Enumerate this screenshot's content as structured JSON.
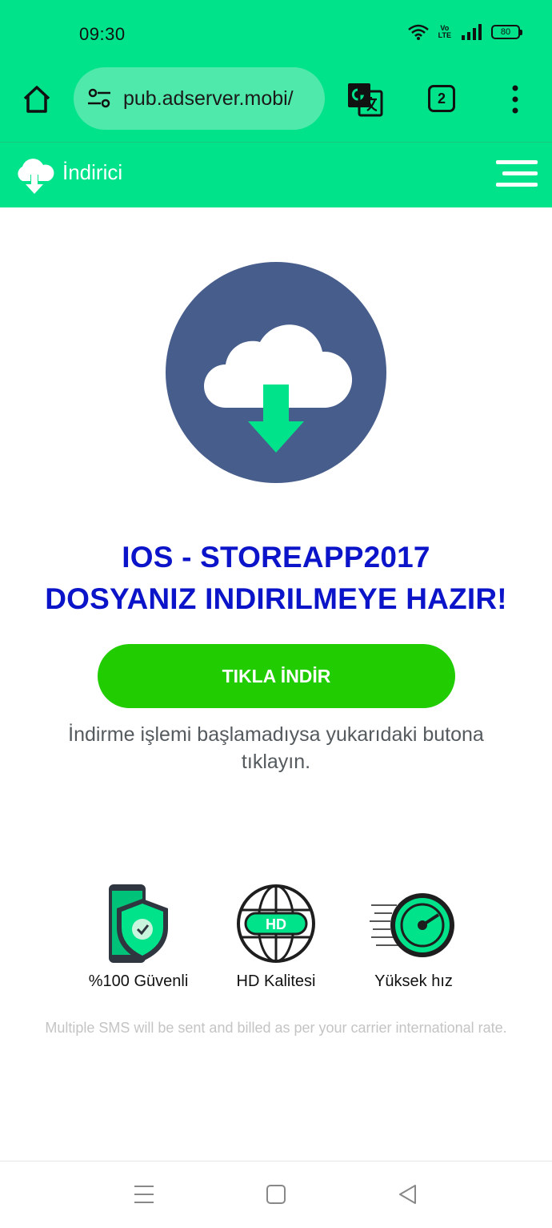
{
  "status_bar": {
    "time": "09:30",
    "battery": "80",
    "volte": "Vo\nLTE"
  },
  "browser": {
    "url": "pub.adserver.mobi/",
    "tab_count": "2",
    "icons": [
      "home-icon",
      "site-settings-icon",
      "translate-icon",
      "tabs-icon",
      "more-vert-icon"
    ]
  },
  "site_header": {
    "logo_text": "İndirici",
    "icons": [
      "cloud-download-icon",
      "hamburger-menu-icon"
    ]
  },
  "hero": {
    "headline_line1": "IOS - STOREAPP2017",
    "headline_line2": "DOSYANIZ INDIRILMEYE HAZIR!",
    "button_label": "TIKLA İNDİR",
    "hint": "İndirme işlemi başlamadıysa yukarıdaki butona tıklayın."
  },
  "features": [
    {
      "label": "%100 Güvenli",
      "icon": "secure-phone-shield-icon"
    },
    {
      "label": "HD Kalitesi",
      "icon": "hd-globe-icon"
    },
    {
      "label": "Yüksek hız",
      "icon": "speedometer-icon"
    }
  ],
  "disclaimer": "Multiple SMS will be sent and billed as per your carrier international rate.",
  "colors": {
    "brand_green": "#00e38b",
    "button_green": "#21cc00",
    "headline_blue": "#0b14c9",
    "circle_blue": "#475d8b"
  }
}
